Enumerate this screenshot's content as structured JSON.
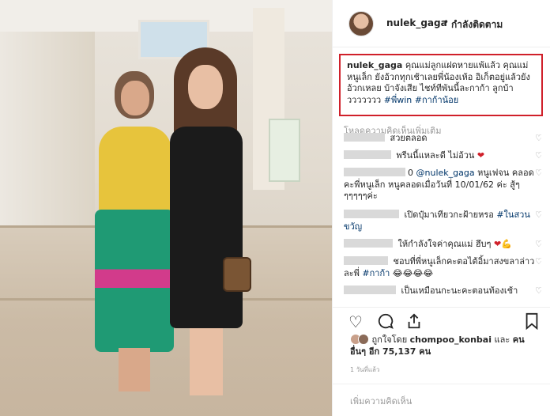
{
  "header": {
    "username": "nulek_gaga",
    "separator": "•",
    "follow_status": "กำลังติดตาม"
  },
  "caption": {
    "username": "nulek_gaga",
    "text": "คุณแม่ลูกแฝดหายแพ้แล้ว คุณแม่หนูเล็ก ยังอ้วกทุกเช้าเลยพี่น้องเห้อ อิเก็ตอยู่แล้วยังอ้วกเหลย บ้าจังเสีย ไชท์ทีพันนี้ละกาก้า ลูกบ้าววววววว",
    "tags": "#พี่win #กาก้าน้อย"
  },
  "load_more": "โหลดความคิดเห็นเพิ่มเติม",
  "comments": [
    {
      "text": "สวยตลอด"
    },
    {
      "text": "พรีนนี้แหละดี ไม่อ้วน",
      "emoji": "❤"
    },
    {
      "prefix": "0",
      "mention": "@nulek_gaga",
      "text": "หนูเฟจน คลอดคะพี่หนูเล็ก หนูคลอดเมื่อวันที่ 10/01/62 ค่ะ สู้ๆๆๆๆๆๆค่ะ"
    },
    {
      "text": "เปิดปุ๋มาเทียวกะฝ้ายหรอ",
      "tag": "#ในสวนขวัญ"
    },
    {
      "text": "ให้กำลังใจค่าคุณแม่ ฮึบๆ",
      "emoji": "❤💪"
    },
    {
      "text": "ชอบที่พี่หนูเล็กคะตอไต้อิ้มาสงขลาล่าวละพี่",
      "tag": "#กาก้า",
      "emoji": "😂😂😂😂"
    },
    {
      "text": "เป็นเหมือนกะนะคะตอนท้องเช้า"
    }
  ],
  "actions": {
    "like_icon": "heart-outline-icon",
    "comment_icon": "comment-icon",
    "share_icon": "share-icon",
    "save_icon": "bookmark-icon"
  },
  "likes": {
    "prefix": "ถูกใจโดย",
    "first_liker": "chompoo_konbai",
    "middle": "และ",
    "others": "คนอื่นๆ อีก 75,137 คน"
  },
  "time_ago": "1 วันที่แล้ว",
  "add_comment_placeholder": "เพิ่มความคิดเห็น"
}
